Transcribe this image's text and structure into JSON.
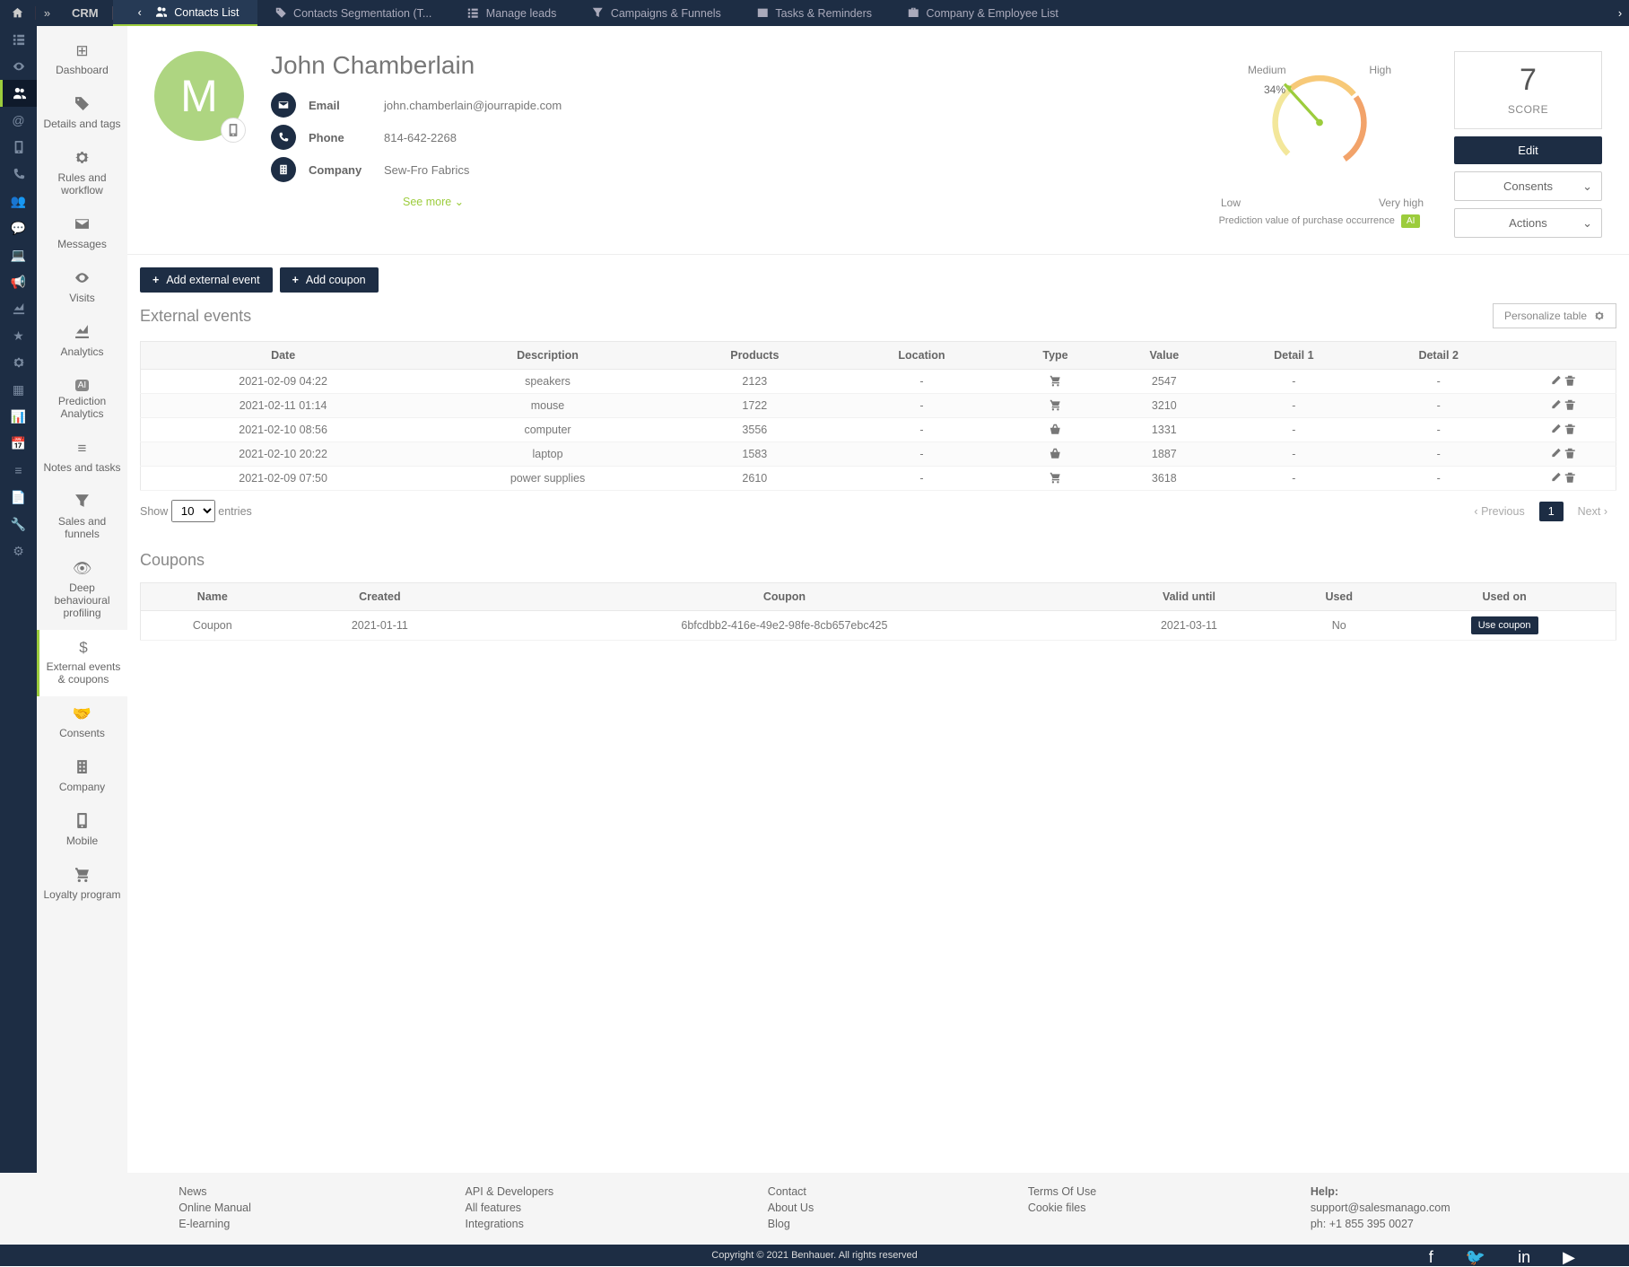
{
  "topbar": {
    "crm": "CRM"
  },
  "tabs": [
    {
      "label": "Contacts List",
      "active": true
    },
    {
      "label": "Contacts Segmentation (T..."
    },
    {
      "label": "Manage leads"
    },
    {
      "label": "Campaigns & Funnels"
    },
    {
      "label": "Tasks & Reminders"
    },
    {
      "label": "Company & Employee List"
    }
  ],
  "sidebar": [
    "Dashboard",
    "Details and tags",
    "Rules and workflow",
    "Messages",
    "Visits",
    "Analytics",
    "Prediction Analytics",
    "Notes and tasks",
    "Sales and funnels",
    "Deep behavioural profiling",
    "External events & coupons",
    "Consents",
    "Company",
    "Mobile",
    "Loyalty program"
  ],
  "contact": {
    "initial": "M",
    "name": "John Chamberlain",
    "email_label": "Email",
    "email": "john.chamberlain@jourrapide.com",
    "phone_label": "Phone",
    "phone": "814-642-2268",
    "company_label": "Company",
    "company": "Sew-Fro Fabrics",
    "see_more": "See more ⌄"
  },
  "gauge": {
    "low": "Low",
    "medium": "Medium",
    "high": "High",
    "veryhigh": "Very high",
    "value": "34%",
    "caption": "Prediction value of purchase occurrence",
    "ai": "AI"
  },
  "score": {
    "value": "7",
    "label": "SCORE"
  },
  "buttons": {
    "edit": "Edit",
    "consents": "Consents",
    "actions": "Actions",
    "add_event": "Add external event",
    "add_coupon": "Add coupon",
    "personalize": "Personalize table"
  },
  "events": {
    "title": "External events",
    "headers": [
      "Date",
      "Description",
      "Products",
      "Location",
      "Type",
      "Value",
      "Detail 1",
      "Detail 2",
      ""
    ],
    "rows": [
      {
        "date": "2021-02-09 04:22",
        "desc": "speakers",
        "prod": "2123",
        "loc": "-",
        "type": "cart",
        "val": "2547",
        "d1": "-",
        "d2": "-"
      },
      {
        "date": "2021-02-11 01:14",
        "desc": "mouse",
        "prod": "1722",
        "loc": "-",
        "type": "cart",
        "val": "3210",
        "d1": "-",
        "d2": "-"
      },
      {
        "date": "2021-02-10 08:56",
        "desc": "computer",
        "prod": "3556",
        "loc": "-",
        "type": "basket",
        "val": "1331",
        "d1": "-",
        "d2": "-"
      },
      {
        "date": "2021-02-10 20:22",
        "desc": "laptop",
        "prod": "1583",
        "loc": "-",
        "type": "basket",
        "val": "1887",
        "d1": "-",
        "d2": "-"
      },
      {
        "date": "2021-02-09 07:50",
        "desc": "power supplies",
        "prod": "2610",
        "loc": "-",
        "type": "cart",
        "val": "3618",
        "d1": "-",
        "d2": "-"
      }
    ],
    "show": "Show",
    "entries": "entries",
    "page_size": "10",
    "prev": "Previous",
    "page": "1",
    "next": "Next"
  },
  "coupons": {
    "title": "Coupons",
    "headers": [
      "Name",
      "Created",
      "Coupon",
      "Valid until",
      "Used",
      "Used on"
    ],
    "rows": [
      {
        "name": "Coupon",
        "created": "2021-01-11",
        "coupon": "6bfcdbb2-416e-49e2-98fe-8cb657ebc425",
        "valid": "2021-03-11",
        "used": "No",
        "action": "Use coupon"
      }
    ]
  },
  "footer": {
    "col1": [
      "News",
      "Online Manual",
      "E-learning"
    ],
    "col2": [
      "API & Developers",
      "All features",
      "Integrations"
    ],
    "col3": [
      "Contact",
      "About Us",
      "Blog"
    ],
    "col4": [
      "Terms Of Use",
      "Cookie files"
    ],
    "help_h": "Help:",
    "help_email": "support@salesmanago.com",
    "help_phone": "ph: +1 855 395 0027",
    "copyright": "Copyright © 2021 Benhauer. All rights reserved"
  }
}
